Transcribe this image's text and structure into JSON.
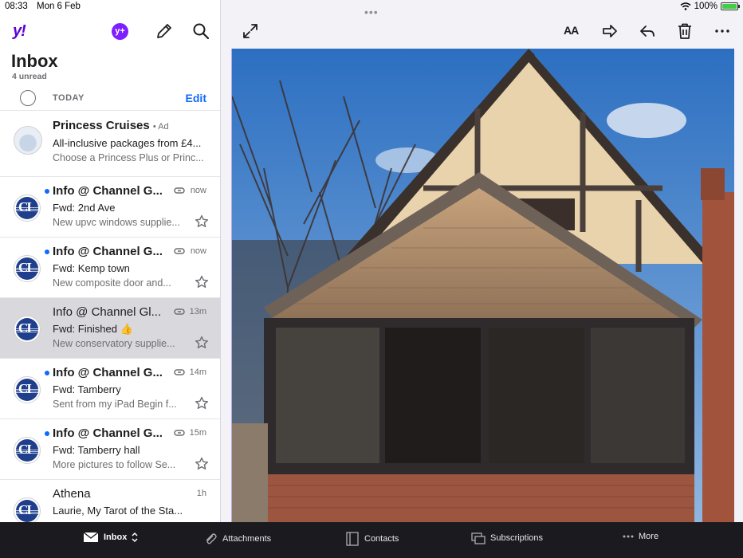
{
  "status_bar": {
    "time": "08:33",
    "date": "Mon 6 Feb",
    "battery": "100%",
    "battery_level": 1.0
  },
  "left_pane": {
    "logo_text": "y!",
    "plus_badge": "y+",
    "title": "Inbox",
    "unread_count": "4 unread",
    "section_label": "TODAY",
    "edit_label": "Edit",
    "messages": [
      {
        "sender": "Princess Cruises",
        "ad_label": "• Ad",
        "subject": "All-inclusive packages from £4...",
        "snippet": "Choose a Princess Plus or Princ...",
        "time": "",
        "unread": false,
        "is_ad": true
      },
      {
        "sender": "Info @ Channel G...",
        "subject": "Fwd: 2nd Ave",
        "snippet": "New upvc windows supplie...",
        "time": "now",
        "unread": true
      },
      {
        "sender": "Info @ Channel G...",
        "subject": "Fwd: Kemp town",
        "snippet": "New composite door and...",
        "time": "now",
        "unread": true
      },
      {
        "sender": "Info @ Channel Gl...",
        "subject": "Fwd: Finished 👍",
        "snippet": "New conservatory supplie...",
        "time": "13m",
        "unread": false,
        "selected": true
      },
      {
        "sender": "Info @ Channel G...",
        "subject": "Fwd: Tamberry",
        "snippet": "Sent from my iPad Begin f...",
        "time": "14m",
        "unread": true
      },
      {
        "sender": "Info @ Channel G...",
        "subject": "Fwd: Tamberry hall",
        "snippet": "More pictures to follow Se...",
        "time": "15m",
        "unread": true
      },
      {
        "sender": "Athena",
        "subject": "Laurie, My Tarot of the Sta...",
        "snippet": "",
        "time": "1h",
        "unread": false
      }
    ]
  },
  "right_pane": {
    "grabber": "•••",
    "font_size_label": "AA"
  },
  "tab_bar": {
    "items": [
      {
        "label": "Inbox",
        "active": true
      },
      {
        "label": "Attachments"
      },
      {
        "label": "Contacts"
      },
      {
        "label": "Subscriptions"
      },
      {
        "label": "More"
      }
    ]
  },
  "colors": {
    "accent_blue": "#0f69ff",
    "yahoo_purple": "#6001d2",
    "plus_purple": "#7e1fff",
    "selected_row": "#d8d8dd",
    "tab_bar_bg": "#1b1b1f"
  }
}
